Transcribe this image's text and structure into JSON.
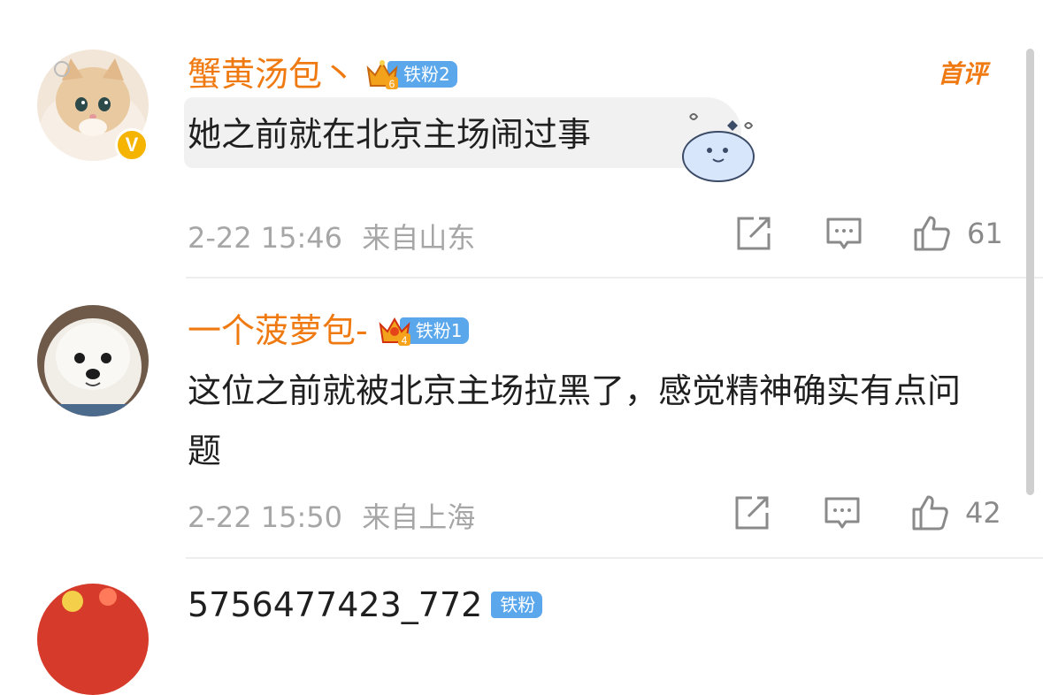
{
  "comments": [
    {
      "username": "蟹黄汤包丶",
      "fan_level_number": "6",
      "fan_label": "铁粉2",
      "text": "她之前就在北京主场闹过事",
      "datetime": "2-22 15:46",
      "location": "来自山东",
      "likes": "61",
      "first_badge": "首评",
      "verified": true
    },
    {
      "username": "一个菠萝包-",
      "fan_level_number": "4",
      "fan_label": "铁粉1",
      "text": "这位之前就被北京主场拉黑了，感觉精神确实有点问题",
      "datetime": "2-22 15:50",
      "location": "来自上海",
      "likes": "42"
    },
    {
      "username": "5756477423_772",
      "fan_label": "铁粉"
    }
  ],
  "colors": {
    "username": "#f07a12",
    "fan_badge_bg": "#5aa7ec",
    "meta_text": "#a6a6a6",
    "verified": "#f5b400"
  },
  "icons": [
    "share-icon",
    "comment-icon",
    "like-icon",
    "verified-icon",
    "crown-icon",
    "sticker-icon"
  ]
}
